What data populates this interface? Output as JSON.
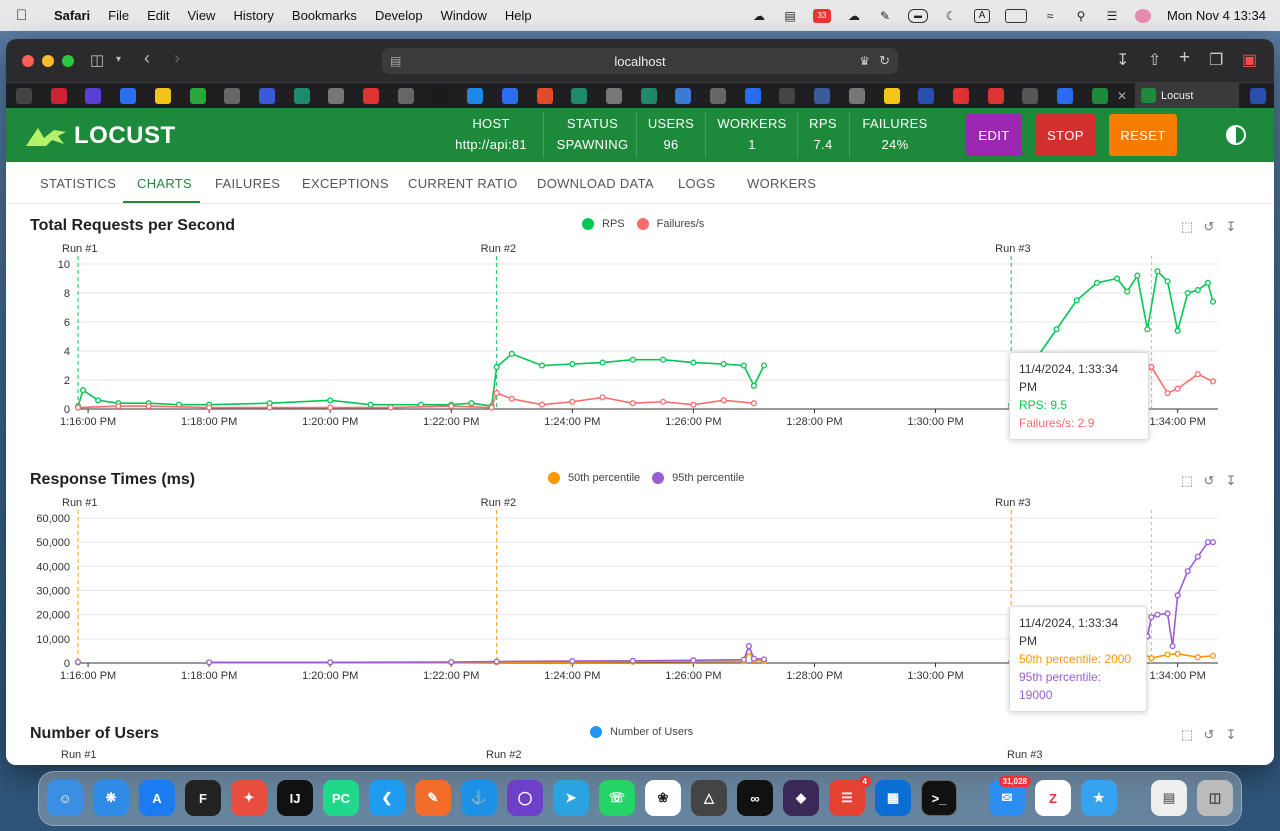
{
  "menubar": {
    "app": "Safari",
    "items": [
      "File",
      "Edit",
      "View",
      "History",
      "Bookmarks",
      "Develop",
      "Window",
      "Help"
    ],
    "clock": "Mon Nov 4  13:34",
    "input_source": "A",
    "badge_count": "33"
  },
  "browser": {
    "url": "localhost",
    "active_tab": "Locust"
  },
  "header": {
    "logo_text": "LOCUST",
    "stats": [
      {
        "label": "HOST",
        "value": "http://api:81"
      },
      {
        "label": "STATUS",
        "value": "SPAWNING"
      },
      {
        "label": "USERS",
        "value": "96"
      },
      {
        "label": "WORKERS",
        "value": "1"
      },
      {
        "label": "RPS",
        "value": "7.4"
      },
      {
        "label": "FAILURES",
        "value": "24%"
      }
    ],
    "buttons": {
      "edit": "EDIT",
      "stop": "STOP",
      "reset": "RESET"
    },
    "colors": {
      "header": "#1d8a3b",
      "edit": "#9c27b0",
      "stop": "#d32f2f",
      "reset": "#f57c00"
    }
  },
  "tabs": [
    "STATISTICS",
    "CHARTS",
    "FAILURES",
    "EXCEPTIONS",
    "CURRENT RATIO",
    "DOWNLOAD DATA",
    "LOGS",
    "WORKERS"
  ],
  "active_tab_index": 1,
  "x_ticks": [
    "1:16:00 PM",
    "1:18:00 PM",
    "1:20:00 PM",
    "1:22:00 PM",
    "1:24:00 PM",
    "1:26:00 PM",
    "1:28:00 PM",
    "1:30:00 PM",
    "1:32:00 PM",
    "1:34:00 PM"
  ],
  "runs": [
    "Run #1",
    "Run #2",
    "Run #3"
  ],
  "chart_data": [
    {
      "type": "line",
      "title": "Total Requests per Second",
      "ylim": [
        0,
        10
      ],
      "y_ticks": [
        "0",
        "2",
        "4",
        "6",
        "8",
        "10"
      ],
      "grid": true,
      "legend_position": "top-center",
      "series": [
        {
          "name": "RPS",
          "color": "#00c853",
          "x": [
            "1:15:50",
            "1:15:55",
            "1:16:10",
            "1:16:30",
            "1:17:00",
            "1:17:30",
            "1:18:00",
            "1:19:00",
            "1:20:00",
            "1:20:40",
            "1:21:30",
            "1:22:00",
            "1:22:20",
            "1:22:40",
            "1:22:45",
            "1:23:00",
            "1:23:30",
            "1:24:00",
            "1:24:30",
            "1:25:00",
            "1:25:30",
            "1:26:00",
            "1:26:30",
            "1:26:50",
            "1:27:00",
            "1:27:10",
            "1:31:15",
            "1:31:25",
            "1:31:40",
            "1:32:00",
            "1:32:20",
            "1:32:40",
            "1:33:00",
            "1:33:10",
            "1:33:20",
            "1:33:30",
            "1:33:40",
            "1:33:50",
            "1:34:00",
            "1:34:10",
            "1:34:20",
            "1:34:30",
            "1:34:35"
          ],
          "y": [
            0.2,
            1.3,
            0.6,
            0.4,
            0.4,
            0.3,
            0.3,
            0.4,
            0.6,
            0.3,
            0.3,
            0.3,
            0.4,
            0.2,
            2.9,
            3.8,
            3.0,
            3.1,
            3.2,
            3.4,
            3.4,
            3.2,
            3.1,
            3.0,
            1.6,
            3.0,
            0.3,
            1.8,
            3.5,
            5.5,
            7.5,
            8.7,
            9.0,
            8.1,
            9.2,
            5.5,
            9.5,
            8.8,
            5.4,
            8.0,
            8.2,
            8.7,
            7.4
          ]
        },
        {
          "name": "Failures/s",
          "color": "#ff6b6b",
          "x": [
            "1:15:50",
            "1:16:30",
            "1:17:00",
            "1:18:00",
            "1:19:00",
            "1:20:00",
            "1:21:00",
            "1:22:00",
            "1:22:40",
            "1:22:45",
            "1:23:00",
            "1:23:30",
            "1:24:00",
            "1:24:30",
            "1:25:00",
            "1:25:30",
            "1:26:00",
            "1:26:30",
            "1:27:00",
            "1:31:15",
            "1:31:40",
            "1:32:00",
            "1:32:20",
            "1:32:40",
            "1:33:00",
            "1:33:20",
            "1:33:34",
            "1:33:50",
            "1:34:00",
            "1:34:20",
            "1:34:35"
          ],
          "y": [
            0.1,
            0.2,
            0.2,
            0.1,
            0.1,
            0.1,
            0.1,
            0.2,
            0.1,
            1.1,
            0.7,
            0.3,
            0.5,
            0.8,
            0.4,
            0.5,
            0.3,
            0.6,
            0.4,
            0.1,
            0.6,
            1.0,
            1.2,
            1.6,
            2.1,
            1.8,
            2.9,
            1.1,
            1.4,
            2.4,
            1.9
          ]
        }
      ],
      "tooltip": {
        "title": "11/4/2024, 1:33:34 PM",
        "lines": [
          "RPS: 9.5",
          "Failures/s: 2.9"
        ]
      }
    },
    {
      "type": "line",
      "title": "Response Times (ms)",
      "ylim": [
        0,
        60000
      ],
      "y_ticks": [
        "0",
        "10,000",
        "20,000",
        "30,000",
        "40,000",
        "50,000",
        "60,000"
      ],
      "grid": true,
      "legend_position": "top-center",
      "series": [
        {
          "name": "50th percentile",
          "color": "#ff9800",
          "x": [
            "1:15:50",
            "1:18:00",
            "1:20:00",
            "1:22:00",
            "1:22:45",
            "1:24:00",
            "1:25:00",
            "1:26:00",
            "1:26:50",
            "1:26:55",
            "1:27:00",
            "1:27:10",
            "1:31:15",
            "1:31:40",
            "1:32:00",
            "1:32:20",
            "1:32:40",
            "1:33:00",
            "1:33:20",
            "1:33:34",
            "1:33:50",
            "1:34:00",
            "1:34:20",
            "1:34:35"
          ],
          "y": [
            200,
            200,
            200,
            200,
            300,
            400,
            500,
            600,
            700,
            4500,
            1200,
            800,
            200,
            600,
            1500,
            2200,
            3000,
            4500,
            5200,
            2000,
            3500,
            3800,
            2400,
            3000
          ]
        },
        {
          "name": "95th percentile",
          "color": "#9c5bd6",
          "x": [
            "1:15:50",
            "1:18:00",
            "1:20:00",
            "1:22:00",
            "1:22:45",
            "1:24:00",
            "1:25:00",
            "1:26:00",
            "1:26:50",
            "1:26:55",
            "1:27:00",
            "1:27:10",
            "1:31:15",
            "1:31:40",
            "1:32:00",
            "1:32:20",
            "1:32:40",
            "1:33:00",
            "1:33:10",
            "1:33:20",
            "1:33:30",
            "1:33:34",
            "1:33:40",
            "1:33:50",
            "1:33:55",
            "1:34:00",
            "1:34:10",
            "1:34:20",
            "1:34:30",
            "1:34:35"
          ],
          "y": [
            400,
            300,
            300,
            400,
            600,
            800,
            900,
            1100,
            1400,
            7000,
            1800,
            1500,
            300,
            900,
            2000,
            3500,
            5000,
            7000,
            8500,
            10000,
            11000,
            19000,
            20000,
            20500,
            7000,
            28000,
            38000,
            44000,
            50000,
            50000
          ]
        }
      ],
      "tooltip": {
        "title": "11/4/2024, 1:33:34 PM",
        "lines": [
          "50th percentile: 2000",
          "95th percentile: 19000"
        ]
      }
    },
    {
      "type": "line",
      "title": "Number of Users",
      "legend_position": "top-center",
      "series": [
        {
          "name": "Number of Users",
          "color": "#2196f3",
          "x": [],
          "y": []
        }
      ]
    }
  ],
  "dock": {
    "mail_badge": "31,028",
    "todoist_badge": "4"
  }
}
